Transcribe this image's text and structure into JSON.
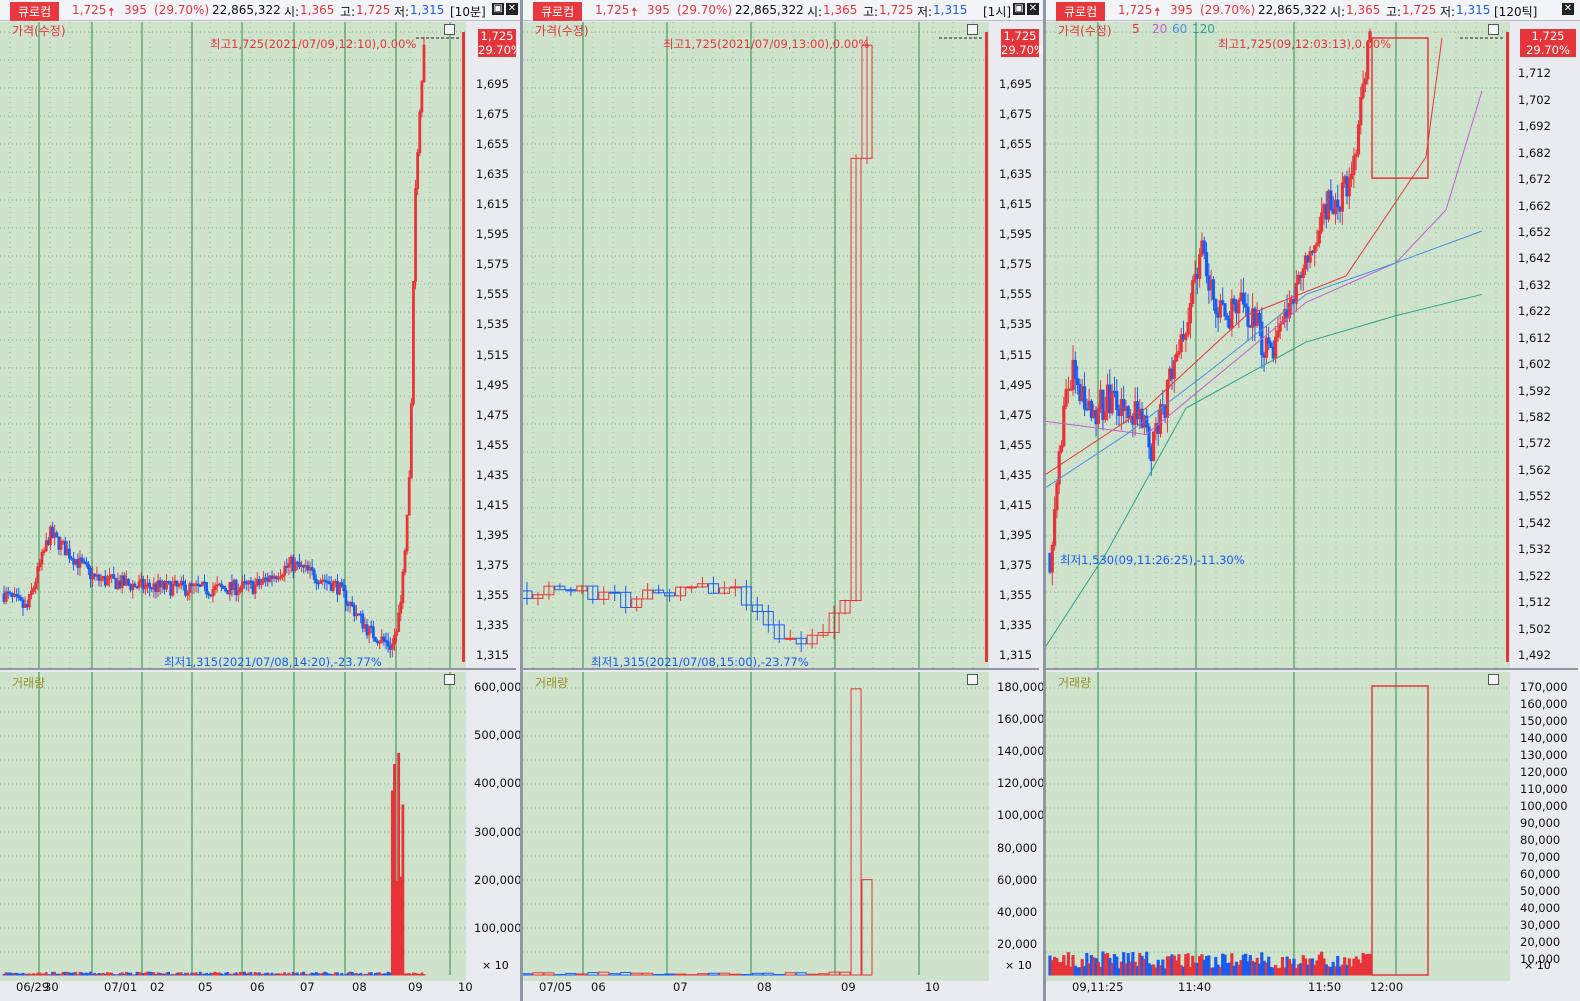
{
  "header": {
    "stock_name": "큐로컴",
    "price": "1,725",
    "change_arrow": "🠅",
    "change": "395",
    "change_pct": "(29.70%)",
    "volume": "22,865,322",
    "open_label": "시:",
    "open": "1,365",
    "high_label": "고:",
    "high": "1,725",
    "low_label": "저:",
    "low": "1,315"
  },
  "common": {
    "price_label": "가격(수정)",
    "volume_label": "거래량",
    "last_price": "1,725",
    "last_pct": "29.70%",
    "vol_unit": "× 10"
  },
  "colors": {
    "up": "#e6353a",
    "down": "#1a5cf0",
    "plot_bg": "#cfe3cc",
    "grid": "#2f8a4e"
  },
  "panels": [
    {
      "period": "[10분]",
      "high_annotation": "최고1,725(2021/07/09,12:10),0.00%",
      "low_annotation": "최저1,315(2021/07/08,14:20),-23.77%",
      "price_ticks": [
        "1,695",
        "1,675",
        "1,655",
        "1,635",
        "1,615",
        "1,595",
        "1,575",
        "1,555",
        "1,535",
        "1,515",
        "1,495",
        "1,475",
        "1,455",
        "1,435",
        "1,415",
        "1,395",
        "1,375",
        "1,355",
        "1,335",
        "1,315"
      ],
      "volume_ticks": [
        "600,000",
        "500,000",
        "400,000",
        "300,000",
        "200,000",
        "100,000"
      ],
      "x_ticks": [
        "06/29",
        "30",
        "07/01",
        "02",
        "05",
        "06",
        "07",
        "08",
        "09",
        "10"
      ]
    },
    {
      "period": "[1시]",
      "high_annotation": "최고1,725(2021/07/09,13:00),0.00%",
      "low_annotation": "최저1,315(2021/07/08,15:00),-23.77%",
      "price_ticks": [
        "1,695",
        "1,675",
        "1,655",
        "1,635",
        "1,615",
        "1,595",
        "1,575",
        "1,555",
        "1,535",
        "1,515",
        "1,495",
        "1,475",
        "1,455",
        "1,435",
        "1,415",
        "1,395",
        "1,375",
        "1,355",
        "1,335",
        "1,315"
      ],
      "volume_ticks": [
        "180,000",
        "160,000",
        "140,000",
        "120,000",
        "100,000",
        "80,000",
        "60,000",
        "40,000",
        "20,000"
      ],
      "x_ticks": [
        "07/05",
        "06",
        "07",
        "08",
        "09",
        "10"
      ]
    },
    {
      "period": "[120틱]",
      "ma_legend": [
        "5",
        "20",
        "60",
        "120"
      ],
      "high_annotation": "최고1,725(09,12:03:13),0.00%",
      "low_annotation": "최저1,530(09,11:26:25),-11.30%",
      "price_ticks": [
        "1,712",
        "1,702",
        "1,692",
        "1,682",
        "1,672",
        "1,662",
        "1,652",
        "1,642",
        "1,632",
        "1,622",
        "1,612",
        "1,602",
        "1,592",
        "1,582",
        "1,572",
        "1,562",
        "1,552",
        "1,542",
        "1,532",
        "1,522",
        "1,512",
        "1,502",
        "1,492"
      ],
      "volume_ticks": [
        "170,000",
        "160,000",
        "150,000",
        "140,000",
        "130,000",
        "120,000",
        "110,000",
        "100,000",
        "90,000",
        "80,000",
        "70,000",
        "60,000",
        "50,000",
        "40,000",
        "30,000",
        "20,000",
        "10,000"
      ],
      "x_ticks": [
        "09,11:25",
        "11:40",
        "11:50",
        "12:00"
      ]
    }
  ],
  "chart_data": [
    {
      "type": "candlestick",
      "title": "큐로컴 10분",
      "x_range": [
        "06/29",
        "07/10"
      ],
      "ylim": [
        1315,
        1725
      ],
      "series": [
        {
          "name": "가격(수정)",
          "path": [
            [
              0,
              1355
            ],
            [
              0.05,
              1345
            ],
            [
              0.1,
              1395
            ],
            [
              0.2,
              1365
            ],
            [
              0.3,
              1360
            ],
            [
              0.45,
              1358
            ],
            [
              0.55,
              1360
            ],
            [
              0.63,
              1375
            ],
            [
              0.73,
              1360
            ],
            [
              0.8,
              1330
            ],
            [
              0.85,
              1320
            ],
            [
              0.87,
              1350
            ],
            [
              0.89,
              1440
            ],
            [
              0.9,
              1620
            ],
            [
              0.92,
              1725
            ]
          ]
        }
      ],
      "volume_ylim": [
        0,
        600000
      ]
    },
    {
      "type": "candlestick",
      "title": "큐로컴 1시",
      "x_range": [
        "07/05",
        "07/10"
      ],
      "ylim": [
        1315,
        1725
      ],
      "volume_ylim": [
        0,
        180000
      ]
    },
    {
      "type": "candlestick",
      "title": "큐로컴 120틱",
      "x_range": [
        "09,11:25",
        "12:03"
      ],
      "ylim": [
        1492,
        1725
      ],
      "moving_averages": [
        "5",
        "20",
        "60",
        "120"
      ],
      "volume_ylim": [
        0,
        170000
      ]
    }
  ]
}
